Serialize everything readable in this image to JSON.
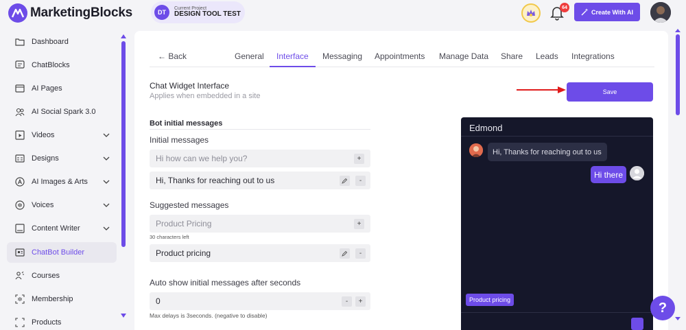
{
  "app": {
    "brand": "MarketingBlocks"
  },
  "project": {
    "initials": "DT",
    "label": "Current Project",
    "name": "DESIGN TOOL TEST"
  },
  "topbar": {
    "notification_count": "64",
    "create_label": "Create With AI"
  },
  "sidebar": {
    "items": [
      {
        "label": "Dashboard",
        "icon": "folder-icon",
        "chevron": false,
        "active": false
      },
      {
        "label": "ChatBlocks",
        "icon": "chat-icon",
        "chevron": false,
        "active": false
      },
      {
        "label": "AI Pages",
        "icon": "page-icon",
        "chevron": false,
        "active": false
      },
      {
        "label": "AI Social Spark 3.0",
        "icon": "people-icon",
        "chevron": false,
        "active": false
      },
      {
        "label": "Videos",
        "icon": "video-icon",
        "chevron": true,
        "active": false
      },
      {
        "label": "Designs",
        "icon": "design-icon",
        "chevron": true,
        "active": false
      },
      {
        "label": "AI Images & Arts",
        "icon": "image-icon",
        "chevron": true,
        "active": false
      },
      {
        "label": "Voices",
        "icon": "voice-icon",
        "chevron": true,
        "active": false
      },
      {
        "label": "Content Writer",
        "icon": "writer-icon",
        "chevron": true,
        "active": false
      },
      {
        "label": "ChatBot Builder",
        "icon": "bot-icon",
        "chevron": false,
        "active": true
      },
      {
        "label": "Courses",
        "icon": "courses-icon",
        "chevron": false,
        "active": false
      },
      {
        "label": "Membership",
        "icon": "membership-icon",
        "chevron": false,
        "active": false
      },
      {
        "label": "Products",
        "icon": "products-icon",
        "chevron": false,
        "active": false
      }
    ]
  },
  "tabs": {
    "back": "← Back",
    "items": [
      "General",
      "Interface",
      "Messaging",
      "Appointments",
      "Manage Data",
      "Share",
      "Leads",
      "Integrations"
    ],
    "active": "Interface"
  },
  "section": {
    "title": "Chat Widget Interface",
    "subtitle": "Applies when embedded in a site",
    "save_label": "Save"
  },
  "bot_messages": {
    "heading": "Bot initial messages",
    "initial_label": "Initial messages",
    "initial_placeholder": "Hi how can we help you?",
    "initial_value": "Hi, Thanks for reaching out to us",
    "suggested_label": "Suggested messages",
    "suggested_placeholder": "Product Pricing",
    "suggested_helper": "30 characters left",
    "suggested_value": "Product pricing",
    "auto_label": "Auto show initial messages after seconds",
    "auto_value": "0",
    "auto_helper": "Max delays is 3seconds. (negative to disable)",
    "add": "+",
    "remove": "-"
  },
  "chat_preview": {
    "bot_name": "Edmond",
    "bot_message": "Hi, Thanks for reaching out to us",
    "user_message": "Hi there",
    "chip": "Product pricing"
  },
  "help": {
    "label": "?"
  },
  "colors": {
    "accent": "#6d4ce8",
    "chat_bg": "#15172a",
    "arrow": "#e01b1b"
  }
}
